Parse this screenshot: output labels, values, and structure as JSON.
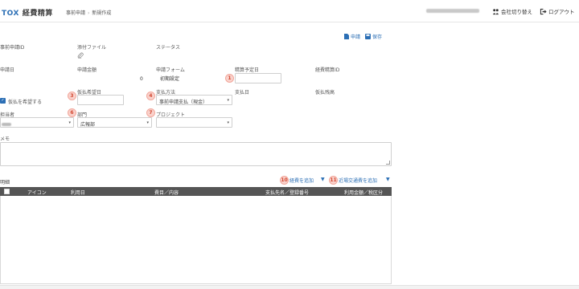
{
  "header": {
    "logo_brand": "TOX",
    "logo_text": "経費精算",
    "breadcrumb": [
      "事前申請",
      "新規作成"
    ],
    "switch_company": "会社切り替え",
    "logout": "ログアウト"
  },
  "actions": {
    "apply": "申請",
    "save": "保存"
  },
  "fields": {
    "request_id": {
      "label": "事前申請ID"
    },
    "attachment": {
      "label": "添付ファイル"
    },
    "status": {
      "label": "ステータス"
    },
    "request_date": {
      "label": "申請日"
    },
    "request_amount": {
      "label": "申請金額",
      "value": "0"
    },
    "request_form": {
      "label": "申請フォーム",
      "value": "初期設定"
    },
    "settlement_date": {
      "label": "精算予定日",
      "value": ""
    },
    "expense_id": {
      "label": "経費精算ID"
    },
    "advance_checkbox": {
      "label": "仮払を希望する",
      "checked": true
    },
    "advance_date": {
      "label": "仮払希望日",
      "value": ""
    },
    "payment_method": {
      "label": "支払方法",
      "value": "事前申請支払（現金）"
    },
    "payment_date": {
      "label": "支払日"
    },
    "advance_balance": {
      "label": "仮払残高"
    },
    "person": {
      "label": "担当者"
    },
    "department": {
      "label": "部門",
      "value": "広報部"
    },
    "project": {
      "label": "プロジェクト",
      "value": ""
    },
    "memo": {
      "label": "メモ"
    }
  },
  "badges": {
    "b1": "1",
    "b3": "3",
    "b4": "4",
    "b6": "6",
    "b7": "7",
    "b10": "10",
    "b11": "11"
  },
  "details": {
    "title": "明細",
    "add_expense": "経費を追加",
    "add_transport": "近場交通費を追加",
    "columns": [
      "アイコン",
      "利用日",
      "費目／内容",
      "支払先名／登録番号",
      "利用金額／税区分"
    ]
  },
  "colors": {
    "accent": "#2c6fb5",
    "badge": "#d34a33",
    "table_header": "#555555"
  }
}
